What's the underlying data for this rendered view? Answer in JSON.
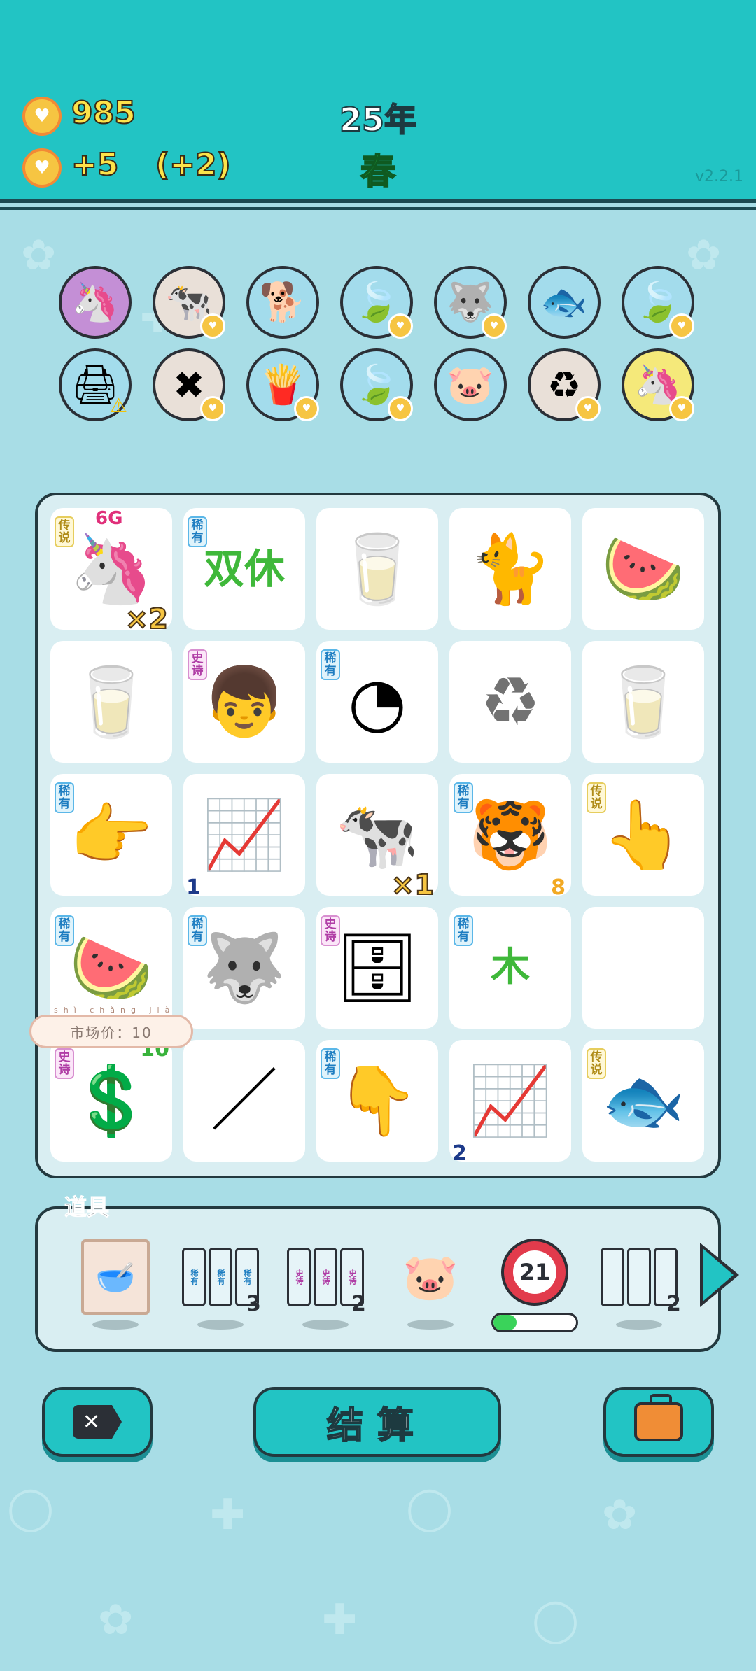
{
  "hud": {
    "coins": "985",
    "income": "+5",
    "bonus": "(+2)",
    "year": "25年",
    "season": "春",
    "version": "v2.2.1"
  },
  "effects_row1": [
    {
      "name": "unicorn-multiplier-effect",
      "icon": "🦄",
      "bg": "#c48fd6",
      "badge": false
    },
    {
      "name": "twin-cow-effect",
      "icon": "🐄",
      "bg": "#e9e0d8",
      "badge": true
    },
    {
      "name": "cool-dog-effect",
      "icon": "🐕",
      "bg": "#a3dcec",
      "badge": false
    },
    {
      "name": "leaf-effect",
      "icon": "🍃",
      "bg": "#a3dcec",
      "badge": true
    },
    {
      "name": "husky-effect",
      "icon": "🐺",
      "bg": "#a3dcec",
      "badge": true
    },
    {
      "name": "fishbowl-effect",
      "icon": "🐟",
      "bg": "#a3dcec",
      "badge": false
    },
    {
      "name": "leaf-effect-2",
      "icon": "🍃",
      "bg": "#a3dcec",
      "badge": true
    }
  ],
  "effects_row2": [
    {
      "name": "printer-effect",
      "icon": "🖨",
      "bg": "#a3dcec",
      "badge": false,
      "warn": true
    },
    {
      "name": "delete-effect",
      "icon": "✖",
      "bg": "#e9e0d8",
      "badge": true
    },
    {
      "name": "fries-effect",
      "icon": "🍟",
      "bg": "#a3dcec",
      "badge": true
    },
    {
      "name": "leaf-effect-3",
      "icon": "🍃",
      "bg": "#a3dcec",
      "badge": true
    },
    {
      "name": "piggy-bank-effect",
      "icon": "🐷",
      "bg": "#a3dcec",
      "badge": false
    },
    {
      "name": "recycle-effect",
      "icon": "♻",
      "bg": "#e9e0d8",
      "badge": true
    },
    {
      "name": "unicorn-effect",
      "icon": "🦄",
      "bg": "#f5e97a",
      "badge": true
    }
  ],
  "tags": {
    "rare": "稀有",
    "epic": "史诗",
    "legend": "传说"
  },
  "board": [
    {
      "name": "unicorn",
      "icon": "🦄",
      "tag": "legend",
      "mult": "×2",
      "top_label": "6G"
    },
    {
      "name": "double-rest",
      "icon": "双休",
      "tag": "rare",
      "text": true
    },
    {
      "name": "milk-bottle",
      "icon": "🥛"
    },
    {
      "name": "cat",
      "icon": "🐈"
    },
    {
      "name": "watermelon-slice",
      "icon": "🍉"
    },
    {
      "name": "milk-bottle-2",
      "icon": "🥛"
    },
    {
      "name": "boy-red-hair",
      "icon": "👦",
      "tag": "epic"
    },
    {
      "name": "speedometer",
      "icon": "◔",
      "tag": "rare"
    },
    {
      "name": "recycle-bowl",
      "icon": "♻",
      "faded": true
    },
    {
      "name": "milk-bottle-3",
      "icon": "🥛"
    },
    {
      "name": "pointing-hand",
      "icon": "👉",
      "tag": "rare"
    },
    {
      "name": "chart-card",
      "icon": "📈",
      "count": "1",
      "count_pos": "bl"
    },
    {
      "name": "cow",
      "icon": "🐄",
      "mult": "×1"
    },
    {
      "name": "tiger",
      "icon": "🐯",
      "tag": "rare",
      "count": "8",
      "count_pos": "br"
    },
    {
      "name": "golden-finger",
      "icon": "👆",
      "tag": "legend"
    },
    {
      "name": "watermelon",
      "icon": "🍉",
      "tag": "rare"
    },
    {
      "name": "husky",
      "icon": "🐺",
      "tag": "rare"
    },
    {
      "name": "server-rack",
      "icon": "🗄",
      "tag": "epic"
    },
    {
      "name": "wood-pentagon",
      "icon": "木",
      "tag": "rare",
      "text": true
    },
    {
      "name": "empty-slot",
      "icon": ""
    },
    {
      "name": "dollar-cycle",
      "icon": "💲",
      "tag": "epic",
      "count": "10",
      "count_pos": "tr"
    },
    {
      "name": "straw",
      "icon": "／"
    },
    {
      "name": "brown-hand",
      "icon": "👇",
      "tag": "rare"
    },
    {
      "name": "chart-card-2",
      "icon": "📈",
      "count": "2",
      "count_pos": "bl"
    },
    {
      "name": "koi-fish",
      "icon": "🐟",
      "tag": "legend"
    }
  ],
  "tooltip": {
    "pinyin": "shì chǎng jià",
    "text": "市场价：10"
  },
  "tray": {
    "title": "道具",
    "slip_rare": "稀有",
    "slip_epic": "史诗",
    "rare_count": "3",
    "epic_count": "2",
    "blank_count": "2",
    "timer": "21",
    "progress": 0.28
  },
  "buttons": {
    "settle": "结算"
  }
}
